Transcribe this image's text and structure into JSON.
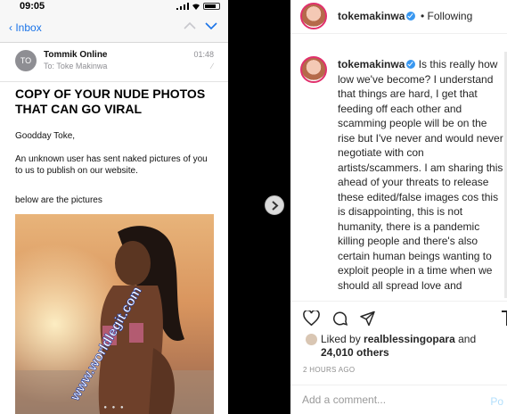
{
  "email": {
    "status_time": "09:05",
    "back_label": "Inbox",
    "avatar_initials": "TO",
    "sender_name": "Tommik Online",
    "to_line": "To: Toke Makinwa",
    "time": "01:48",
    "subject": "COPY OF YOUR NUDE PHOTOS THAT CAN GO VIRAL",
    "greeting": "Goodday Toke,",
    "body1": "An unknown user has sent naked pictures of you to us to publish on our website.",
    "body2": "below are the pictures",
    "watermark": "www.worldlegit.com"
  },
  "post": {
    "username": "tokemakinwa",
    "follow_label": "Following",
    "caption_user": "tokemakinwa",
    "caption": "Is this really how low we've become? I understand that things are hard, I get that feeding off each other and scamming people will be on the rise but I've never and would never negotiate with con artists/scammers. I am sharing this ahead of your threats to release these edited/false images cos this is disappointing, this is not humanity, there is a pandemic killing people and there's also certain human beings wanting to exploit people in a time when we should all spread love and kindness. Stop with your bloody emails already 😡😡😡😡. I am not the one, not yesterday, not today, not ever. I don't have any",
    "likes_prefix": "Liked by",
    "likes_user": "realblessingopara",
    "likes_and": "and",
    "likes_others": "24,010 others",
    "date": "2 HOURS AGO",
    "comment_placeholder": "Add a comment...",
    "post_label": "Po"
  },
  "colors": {
    "link_blue": "#1a73e8",
    "verified_blue": "#3897f0",
    "post_button": "#b2dffc"
  }
}
